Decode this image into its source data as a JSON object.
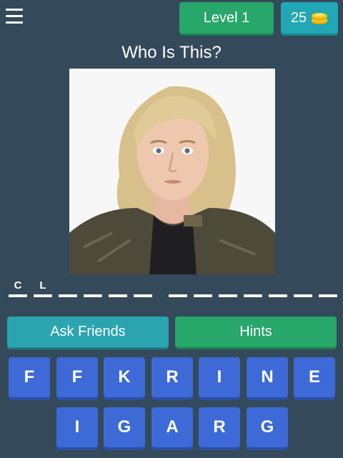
{
  "header": {
    "level_label": "Level 1",
    "coins": "25"
  },
  "question": "Who Is This?",
  "answer_slots": [
    "C",
    "L",
    "",
    "",
    "",
    "",
    "",
    "",
    "",
    "",
    "",
    "",
    "",
    "",
    "",
    ""
  ],
  "buttons": {
    "ask_friends": "Ask Friends",
    "hints": "Hints"
  },
  "keyboard": {
    "row1": [
      "F",
      "F",
      "K",
      "R",
      "I",
      "N",
      "E"
    ],
    "row2": [
      "I",
      "G",
      "A",
      "R",
      "G"
    ]
  },
  "colors": {
    "background": "#34495a",
    "green": "#27a76a",
    "teal": "#2aa5b0",
    "key_blue": "#3d6ad6",
    "coin_yellow": "#f5c518"
  }
}
